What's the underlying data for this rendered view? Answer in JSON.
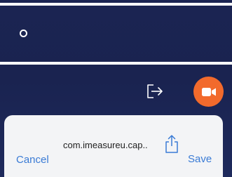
{
  "sheet": {
    "title": "com.imeasureu.cap..",
    "cancel_label": "Cancel",
    "save_label": "Save"
  },
  "icons": {
    "exit": "exit-icon",
    "record": "video-camera-icon",
    "share": "share-icon",
    "indicator": "circle-indicator-icon"
  },
  "colors": {
    "background": "#1b2452",
    "record_button": "#f26a2c",
    "action_text": "#3a7bd5",
    "sheet_background": "#f3f4f6"
  }
}
